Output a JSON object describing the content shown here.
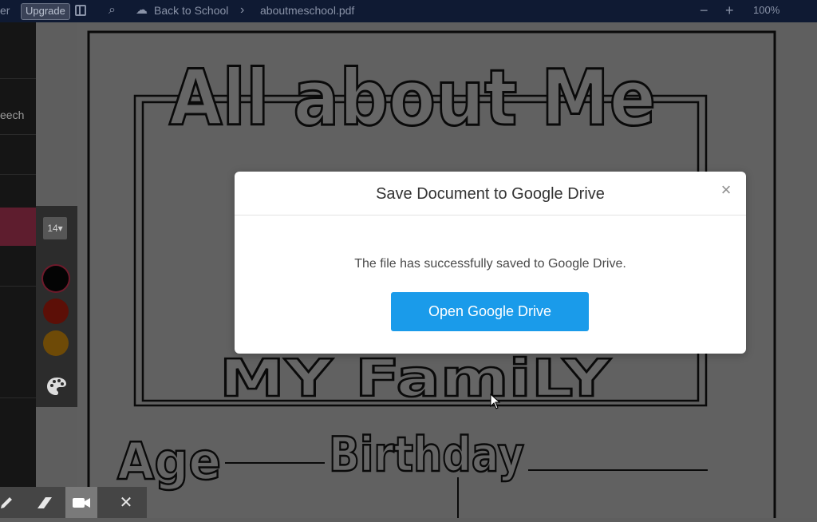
{
  "topbar": {
    "user_fragment": "er",
    "upgrade_label": "Upgrade",
    "breadcrumb_folder": "Back to School",
    "breadcrumb_sep": "›",
    "file_name": "aboutmeschool.pdf",
    "zoom_out": "−",
    "zoom_in": "+",
    "zoom_level": "100%"
  },
  "sidebar": {
    "speech_fragment": "eech"
  },
  "tools": {
    "font_size": "14▾",
    "colors": [
      "#040404",
      "#5c0f07",
      "#6e4a07"
    ],
    "palette_icon": "palette-icon"
  },
  "document": {
    "title_art": "All about Me",
    "family_art": "MY FamiLY",
    "age_art": "Age",
    "birthday_art": "Birthday"
  },
  "bottom_tools": {
    "items": [
      "pencil-icon",
      "eraser-icon",
      "video-camera-icon",
      "close-icon"
    ],
    "close_label": "✕"
  },
  "modal": {
    "title": "Save Document to Google Drive",
    "close_label": "×",
    "message": "The file has successfully saved to Google Drive.",
    "button_label": "Open Google Drive",
    "button_color": "#1a9bea"
  }
}
